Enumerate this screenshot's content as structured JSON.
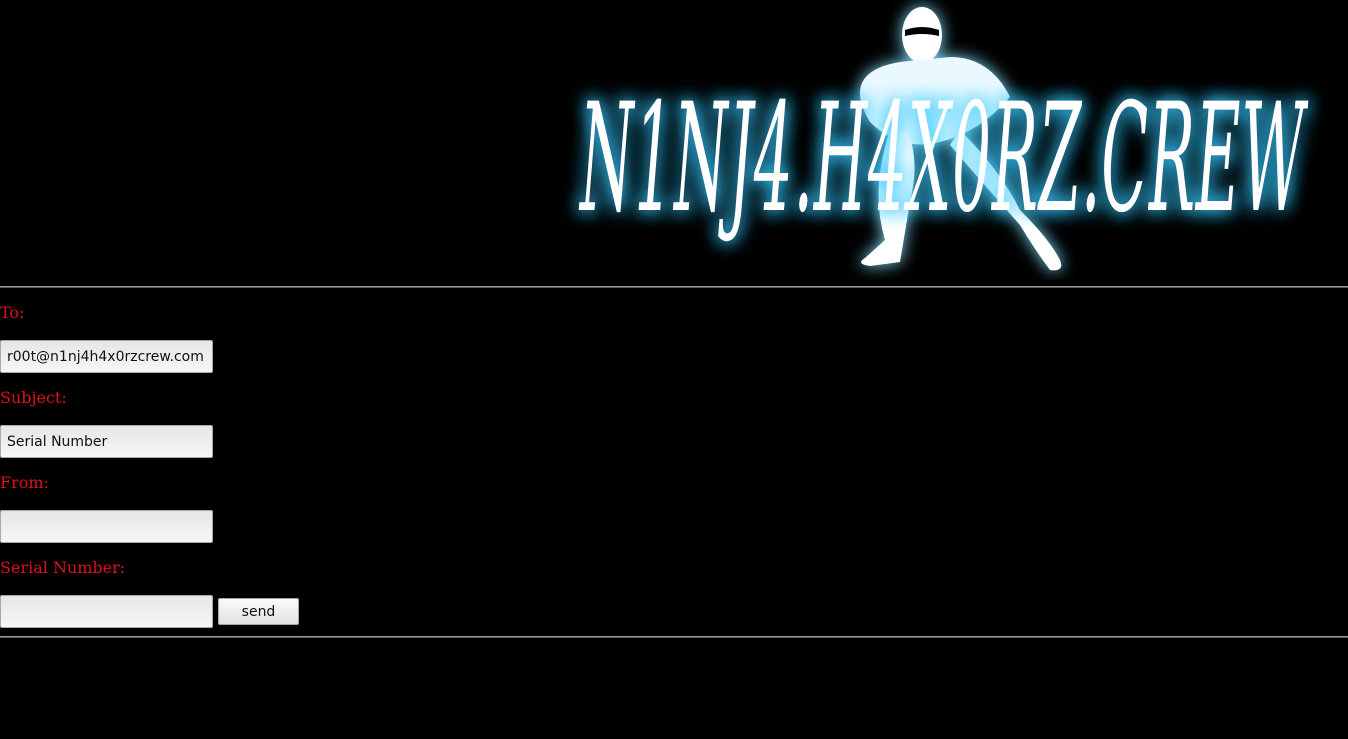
{
  "header": {
    "logo_text": "N1NJ4.H4X0RZ.CREW",
    "logo_icon": "ninja-silhouette-icon",
    "glow_color": "#35c8ff"
  },
  "form": {
    "to_label": "To:",
    "to_value": "r00t@n1nj4h4x0rzcrew.com",
    "subject_label": "Subject:",
    "subject_value": "Serial Number",
    "from_label": "From:",
    "from_value": "",
    "serial_label": "Serial Number:",
    "serial_value": "",
    "send_label": "send"
  },
  "colors": {
    "background": "#000000",
    "label": "#e0121a"
  }
}
